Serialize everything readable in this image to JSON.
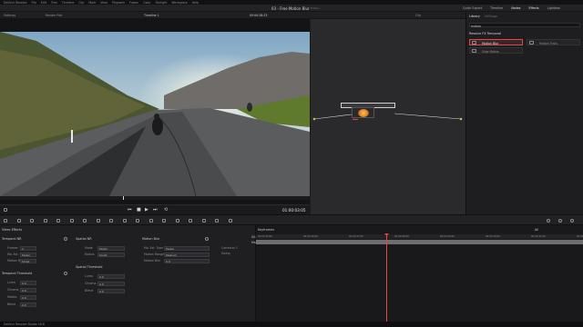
{
  "app": {
    "menu": [
      "DaVinci Resolve",
      "File",
      "Edit",
      "Trim",
      "Timeline",
      "Clip",
      "Mark",
      "View",
      "Playback",
      "Fusion",
      "Color",
      "Fairlight",
      "Workspace",
      "Help"
    ],
    "project_title": "03 - Free Motion Blur",
    "edited": "Edited",
    "top_right": [
      "Quick Export",
      "Timeline",
      "Nodes",
      "Effects",
      "Lightbox"
    ]
  },
  "viewer": {
    "tools": [
      "Settings",
      "Render Plot"
    ],
    "timeline_name": "Timeline 1",
    "source_tc": "00:00:28:23",
    "clip_label": "Clip",
    "transport": [
      "prev",
      "stop",
      "play",
      "next",
      "loop"
    ],
    "timecode": "01:00:03:05"
  },
  "library": {
    "tabs": [
      "Library",
      "Settings"
    ],
    "search_value": "motion",
    "group": "Resolve FX Temporal",
    "items": [
      "Motion Blur",
      "Motion Trails",
      "Slow Motion"
    ]
  },
  "inspector": {
    "section_effects": "Video Effects",
    "temporal_nr": {
      "title": "Temporal NR",
      "rows": [
        {
          "label": "Frames",
          "value": "2"
        },
        {
          "label": "Mo. Est. Type",
          "value": "Faster"
        },
        {
          "label": "Motion Range",
          "value": "Small"
        }
      ]
    },
    "temporal_threshold": {
      "title": "Temporal Threshold",
      "rows": [
        {
          "label": "Luma",
          "value": "0.0"
        },
        {
          "label": "Chroma",
          "value": "0.0"
        },
        {
          "label": "Motion",
          "value": "0.0"
        },
        {
          "label": "Blend",
          "value": "0.0"
        }
      ]
    },
    "spatial_nr": {
      "title": "Spatial NR",
      "rows": [
        {
          "label": "Mode",
          "value": "Faster"
        },
        {
          "label": "Radius",
          "value": "Small"
        }
      ]
    },
    "spatial_threshold": {
      "title": "Spatial Threshold",
      "rows": [
        {
          "label": "Luma",
          "value": "0.0"
        },
        {
          "label": "Chroma",
          "value": "0.0"
        },
        {
          "label": "Blend",
          "value": "0.0"
        }
      ]
    },
    "motion_blur": {
      "title": "Motion Blur",
      "rows": [
        {
          "label": "Mo. Est. Type",
          "value": "Faster"
        },
        {
          "label": "Motion Range",
          "value": "Medium"
        },
        {
          "label": "Motion Blur",
          "value": "0.0"
        }
      ]
    }
  },
  "keyframes": {
    "title": "Keyframes",
    "filter": "All",
    "master_tc": "00:00:28:23",
    "master": "Master",
    "tracks": [
      "Corrector 1",
      "Sizing"
    ],
    "ruler": [
      "00:00:25:00",
      "00:00:26:00",
      "00:00:27:00",
      "00:00:28:00",
      "00:00:29:00",
      "00:00:30:00",
      "00:00:31:00",
      "00:00:32:00"
    ]
  },
  "status": {
    "app_version": "DaVinci Resolve Studio 18.6"
  },
  "colors": {
    "accent_red": "#e0464a",
    "playhead": "#e8473b",
    "node_orange": "#e89a2c"
  }
}
